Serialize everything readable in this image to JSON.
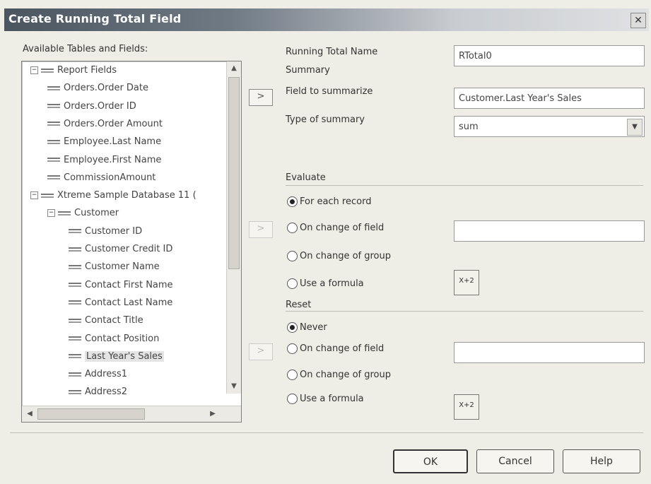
{
  "window": {
    "title": "Create Running Total Field",
    "close_glyph": "✕"
  },
  "left": {
    "label": "Available Tables and Fields:",
    "tree": [
      {
        "text": "Report Fields",
        "level": 0,
        "expander": "−",
        "icon": "report-fields-icon"
      },
      {
        "text": "Orders.Order Date",
        "level": 1,
        "icon": "field-icon"
      },
      {
        "text": "Orders.Order ID",
        "level": 1,
        "icon": "field-icon"
      },
      {
        "text": "Orders.Order Amount",
        "level": 1,
        "icon": "field-icon"
      },
      {
        "text": "Employee.Last Name",
        "level": 1,
        "icon": "field-icon"
      },
      {
        "text": "Employee.First Name",
        "level": 1,
        "icon": "field-icon"
      },
      {
        "text": "CommissionAmount",
        "level": 1,
        "icon": "formula-field-icon"
      },
      {
        "text": "Xtreme Sample Database 11 (",
        "level": 0,
        "expander": "−",
        "icon": "database-icon"
      },
      {
        "text": "Customer",
        "level": 1,
        "expander": "−",
        "icon": "table-icon"
      },
      {
        "text": "Customer ID",
        "level": 2,
        "icon": "field-icon"
      },
      {
        "text": "Customer Credit ID",
        "level": 2,
        "icon": "field-icon"
      },
      {
        "text": "Customer Name",
        "level": 2,
        "icon": "field-icon"
      },
      {
        "text": "Contact First Name",
        "level": 2,
        "icon": "field-icon"
      },
      {
        "text": "Contact Last Name",
        "level": 2,
        "icon": "field-icon"
      },
      {
        "text": "Contact Title",
        "level": 2,
        "icon": "field-icon"
      },
      {
        "text": "Contact Position",
        "level": 2,
        "icon": "field-icon"
      },
      {
        "text": "Last Year's Sales",
        "level": 2,
        "icon": "field-icon",
        "selected": true
      },
      {
        "text": "Address1",
        "level": 2,
        "icon": "field-icon"
      },
      {
        "text": "Address2",
        "level": 2,
        "icon": "field-icon"
      }
    ]
  },
  "arrows": {
    "add_summary": ">",
    "add_field_eval": ">",
    "add_field_reset": ">"
  },
  "right": {
    "running_total_name_label": "Running Total Name",
    "running_total_name_value": "RTotal0",
    "summary_label": "Summary",
    "field_to_summarize_label": "Field to summarize",
    "field_to_summarize_value": "Customer.Last Year's Sales",
    "type_of_summary_label": "Type of summary",
    "type_of_summary_value": "sum",
    "evaluate_label": "Evaluate",
    "evaluate_options": [
      "For each record",
      "On change of field",
      "On change of group",
      "Use a formula"
    ],
    "evaluate_selected": 0,
    "reset_label": "Reset",
    "reset_options": [
      "Never",
      "On change of field",
      "On change of group",
      "Use a formula"
    ],
    "reset_selected": 0,
    "formula_icon_text": "X+2"
  },
  "buttons": {
    "ok": "OK",
    "cancel": "Cancel",
    "help": "Help"
  }
}
